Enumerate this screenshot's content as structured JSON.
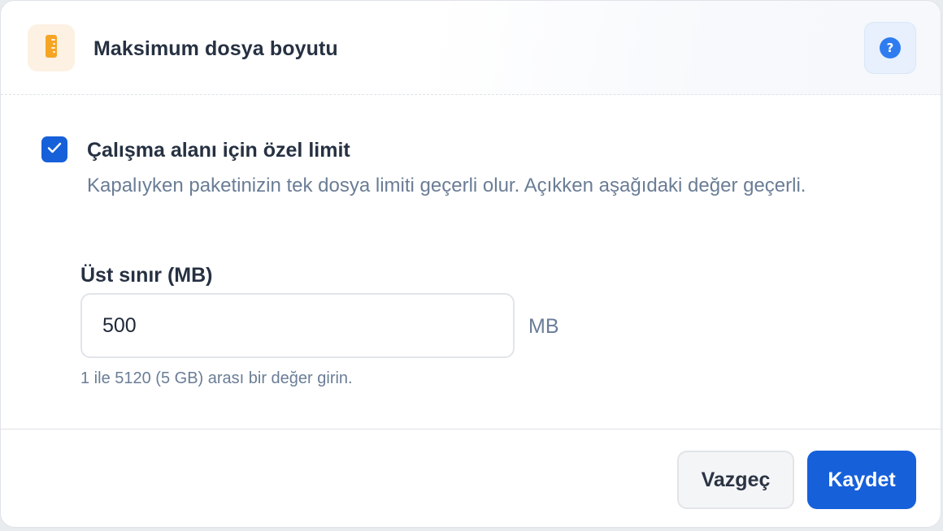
{
  "header": {
    "title": "Maksimum dosya boyutu",
    "icon": "ruler-icon",
    "help_icon": "question-circle-icon",
    "help_symbol": "?"
  },
  "custom_limit": {
    "checked": true,
    "title": "Çalışma alanı için özel limit",
    "description": "Kapalıyken paketinizin tek dosya limiti geçerli olur. Açıkken aşağıdaki değer geçerli."
  },
  "upper_limit": {
    "label": "Üst sınır (MB)",
    "value": "500",
    "unit": "MB",
    "hint": "1 ile 5120 (5 GB) arası bir değer girin."
  },
  "footer": {
    "cancel_label": "Vazgeç",
    "save_label": "Kaydet"
  },
  "colors": {
    "accent": "#1660da",
    "icon_orange": "#f5a524",
    "help_blue": "#2f7cf0",
    "text_dark": "#263142",
    "text_muted": "#6a7d96"
  }
}
